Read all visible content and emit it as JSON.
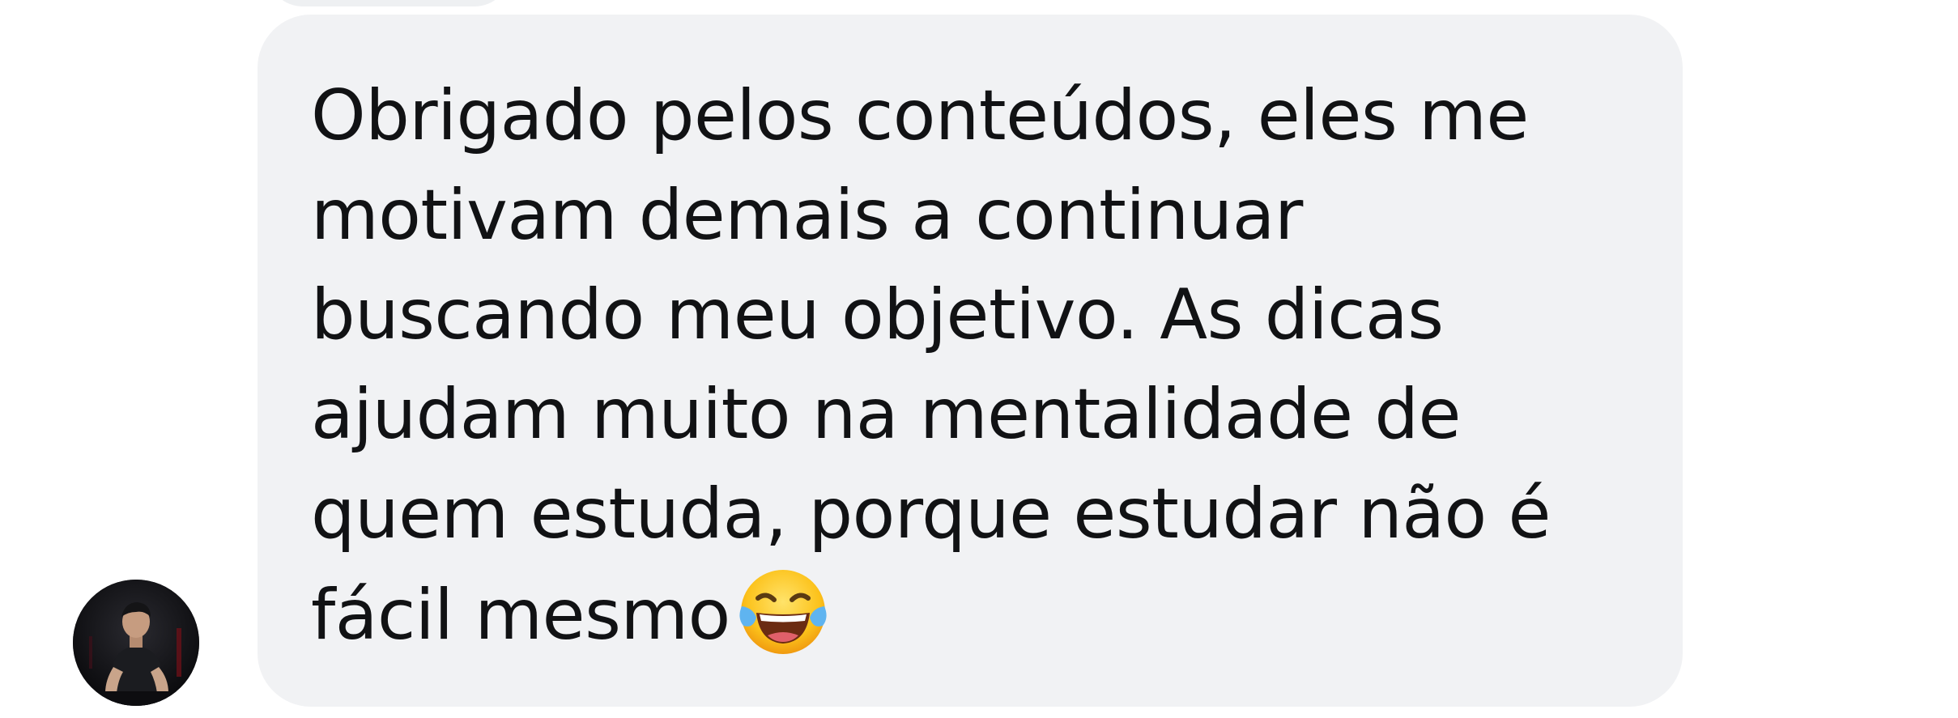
{
  "conversation": {
    "message": {
      "text": "Obrigado pelos conteúdos, eles me\nmotivam demais a continuar\nbuscando meu objetivo. As dicas\najudam muito na mentalidade de\nquem estuda, porque estudar não é\nfácil mesmo",
      "emoji": "face-with-tears-of-joy-icon"
    },
    "sender": {
      "avatar_icon": "profile-photo-icon"
    }
  },
  "colors": {
    "bubble_background": "#f1f2f4",
    "text": "#111214",
    "page_background": "#ffffff"
  }
}
